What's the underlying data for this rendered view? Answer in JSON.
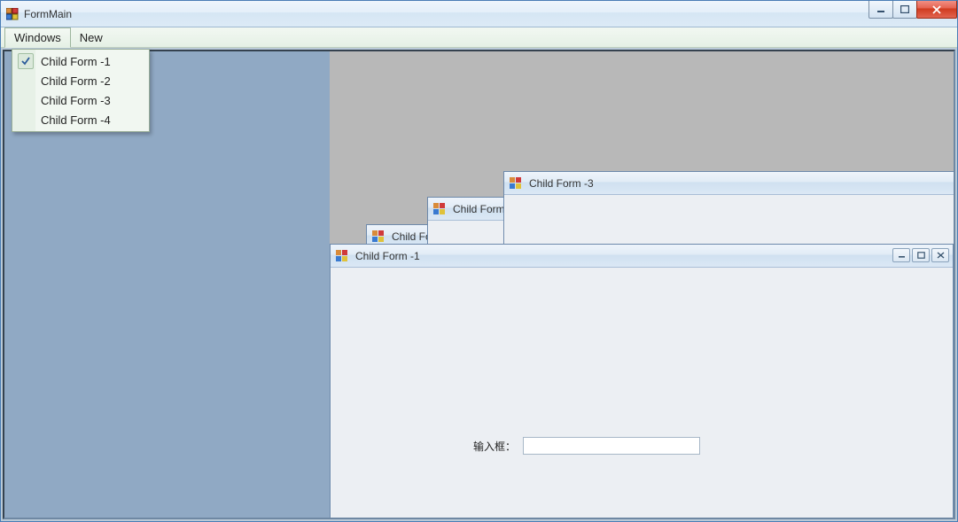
{
  "window": {
    "title": "FormMain"
  },
  "menu": {
    "windows_label": "Windows",
    "new_label": "New",
    "items": [
      {
        "label": "Child Form -1",
        "checked": true
      },
      {
        "label": "Child Form -2",
        "checked": false
      },
      {
        "label": "Child Form -3",
        "checked": false
      },
      {
        "label": "Child Form -4",
        "checked": false
      }
    ]
  },
  "child_forms": {
    "form4": {
      "title": "Child Fo"
    },
    "form2": {
      "title": "Child Form"
    },
    "form3": {
      "title": "Child Form -3"
    },
    "form1": {
      "title": "Child Form -1",
      "input_label": "输入框：",
      "input_value": ""
    }
  }
}
